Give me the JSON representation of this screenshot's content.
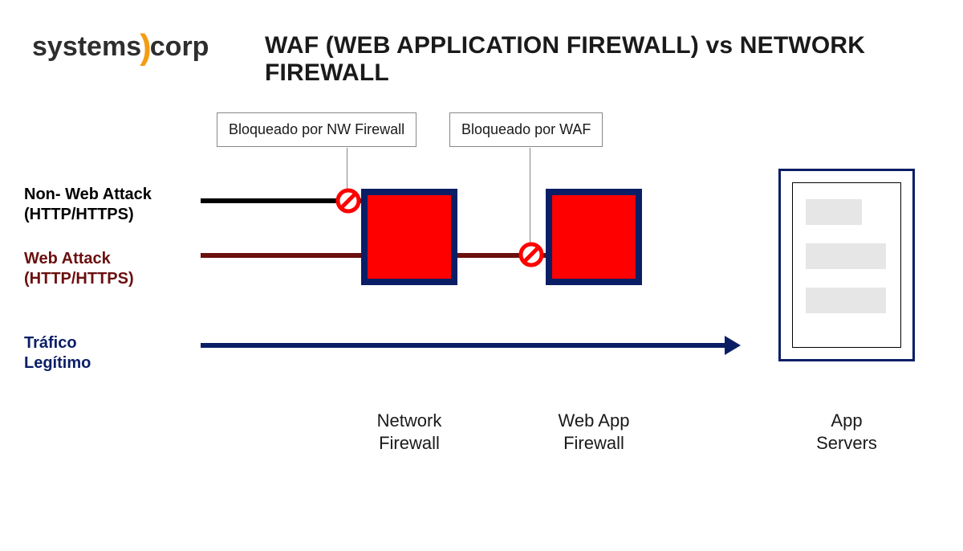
{
  "logo": {
    "left": "systems",
    "right": "corp"
  },
  "title": "WAF (WEB APPLICATION FIREWALL) vs NETWORK FIREWALL",
  "callouts": {
    "nw": "Bloqueado por NW Firewall",
    "waf": "Bloqueado por WAF"
  },
  "flows": {
    "nonweb_line1": "Non- Web Attack",
    "nonweb_line2": "(HTTP/HTTPS)",
    "web_line1": "Web Attack",
    "web_line2": "(HTTP/HTTPS)",
    "legit_line1": "Tráfico",
    "legit_line2": "Legítimo"
  },
  "components": {
    "nwfw_line1": "Network",
    "nwfw_line2": "Firewall",
    "waf_line1": "Web App",
    "waf_line2": "Firewall",
    "servers_line1": "App",
    "servers_line2": "Servers"
  },
  "colors": {
    "brand_accent": "#f39c12",
    "firewall_fill": "#ff0000",
    "firewall_border": "#0a1e66",
    "nonweb_line": "#000000",
    "web_line": "#6b0f0f",
    "legit_line": "#0a1e66"
  }
}
